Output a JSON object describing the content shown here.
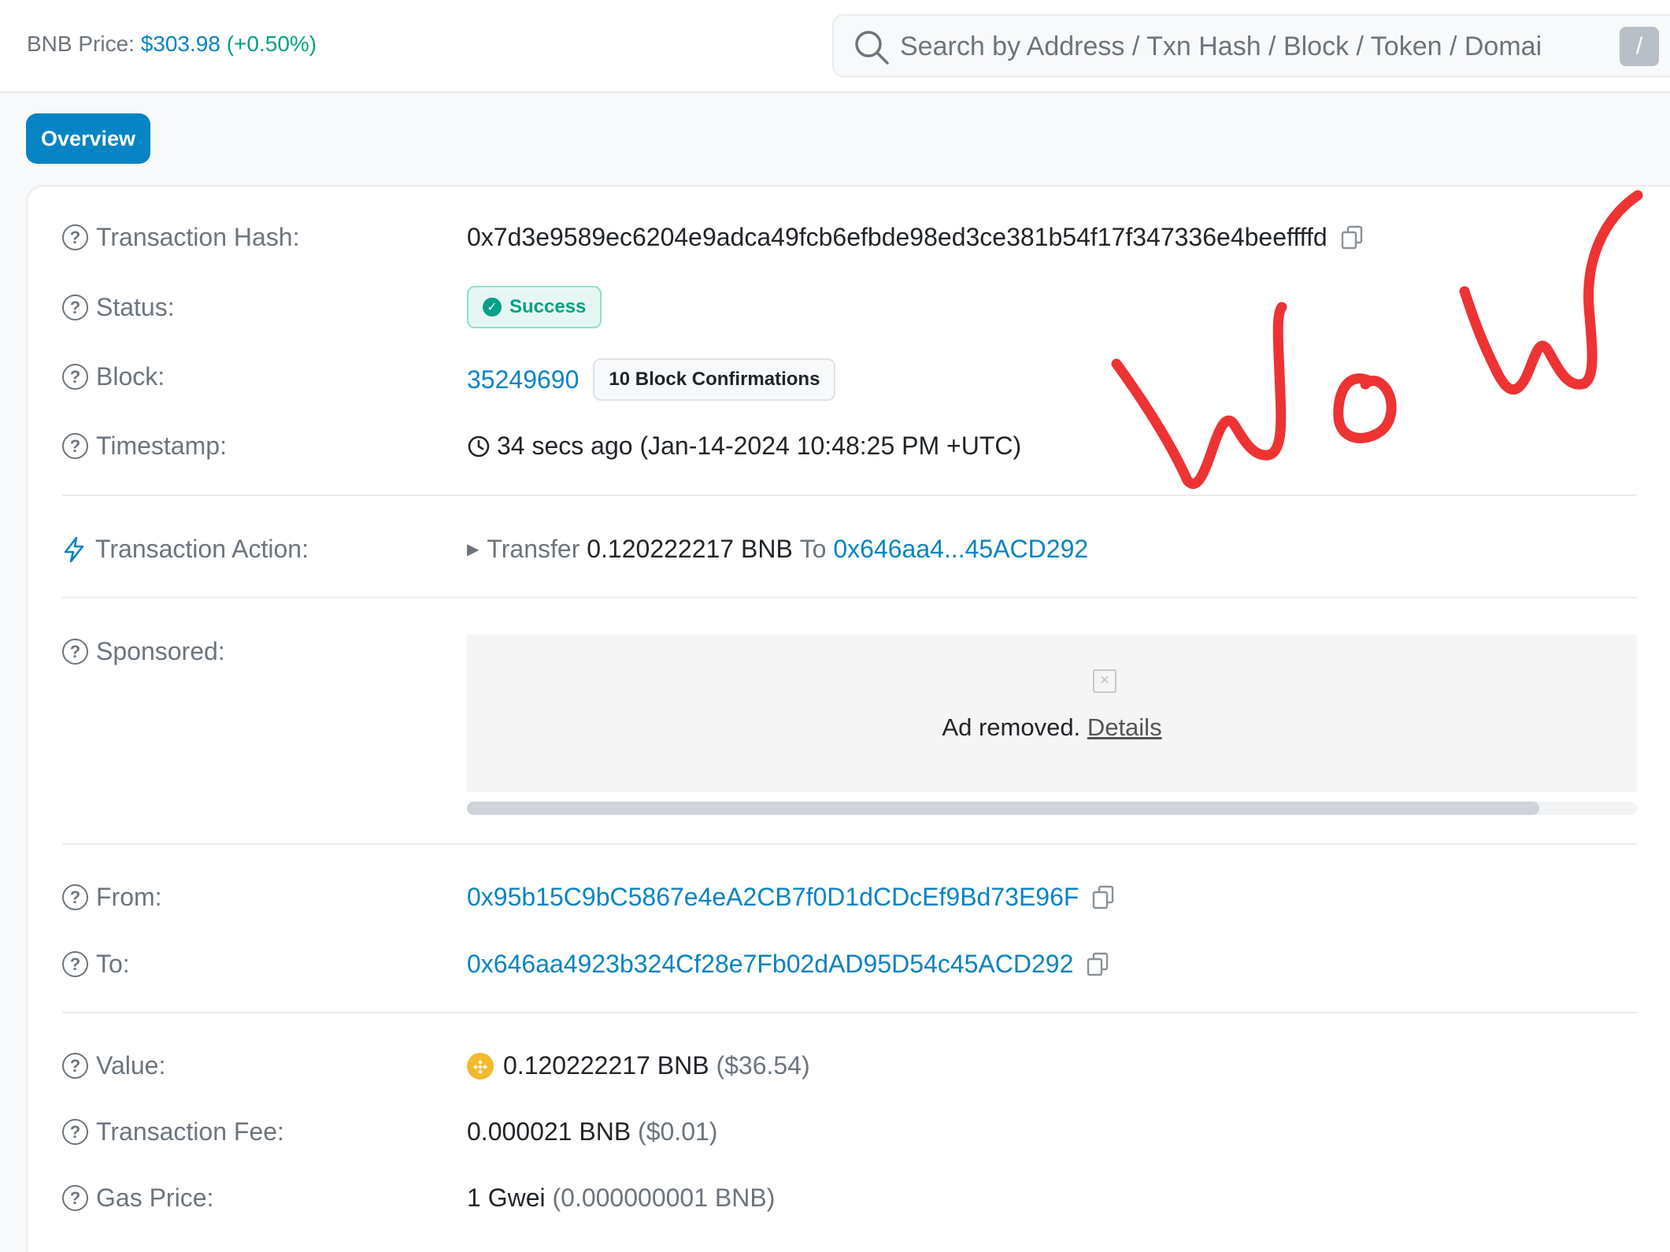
{
  "header": {
    "price_label": "BNB Price:",
    "price_value": "$303.98",
    "price_change": "(+0.50%)",
    "search_placeholder": "Search by Address / Txn Hash / Block / Token / Domai",
    "search_shortcut": "/"
  },
  "tabs": [
    {
      "label": "Overview",
      "active": true
    }
  ],
  "details": {
    "tx_hash": {
      "label": "Transaction Hash:",
      "value": "0x7d3e9589ec6204e9adca49fcb6efbde98ed3ce381b54f17f347336e4beeffffd"
    },
    "status": {
      "label": "Status:",
      "value": "Success"
    },
    "block": {
      "label": "Block:",
      "value": "35249690",
      "confirmations": "10 Block Confirmations"
    },
    "timestamp": {
      "label": "Timestamp:",
      "value": "34 secs ago (Jan-14-2024 10:48:25 PM +UTC)"
    },
    "action": {
      "label": "Transaction Action:",
      "verb": "Transfer",
      "amount": "0.120222217 BNB",
      "to_word": "To",
      "to_addr": "0x646aa4...45ACD292"
    },
    "sponsored": {
      "label": "Sponsored:",
      "ad_text": "Ad removed.",
      "ad_link": "Details"
    },
    "from": {
      "label": "From:",
      "value": "0x95b15C9bC5867e4eA2CB7f0D1dCDcEf9Bd73E96F"
    },
    "to": {
      "label": "To:",
      "value": "0x646aa4923b324Cf28e7Fb02dAD95D54c45ACD292"
    },
    "value": {
      "label": "Value:",
      "amount": "0.120222217 BNB",
      "usd": "($36.54)"
    },
    "fee": {
      "label": "Transaction Fee:",
      "amount": "0.000021 BNB",
      "usd": "($0.01)"
    },
    "gas": {
      "label": "Gas Price:",
      "amount": "1 Gwei",
      "bnb": "(0.000000001 BNB)"
    }
  },
  "annotation": {
    "text": "WoW",
    "color": "#ee3333"
  },
  "colors": {
    "link": "#0784c3",
    "success": "#00a186",
    "muted": "#6c757d"
  }
}
